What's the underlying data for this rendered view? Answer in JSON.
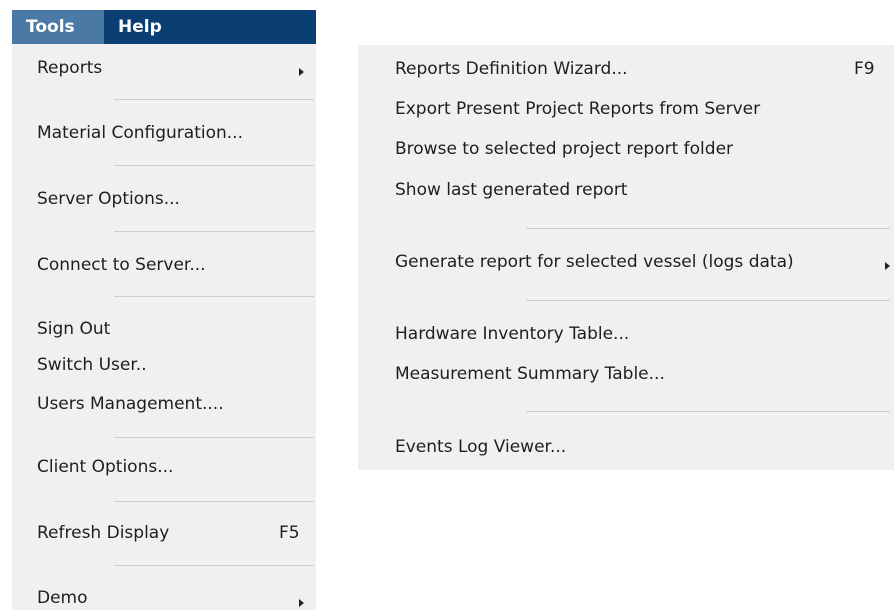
{
  "menubar": {
    "tools": "Tools",
    "help": "Help"
  },
  "tools_menu": {
    "reports": "Reports",
    "material_configuration": "Material Configuration...",
    "server_options": "Server Options...",
    "connect_to_server": "Connect to Server...",
    "sign_out": "Sign Out",
    "switch_user": "Switch User..",
    "users_management": "Users Management....",
    "client_options": "Client Options...",
    "refresh_display": "Refresh Display",
    "refresh_display_shortcut": "F5",
    "demo": "Demo"
  },
  "reports_submenu": {
    "reports_definition_wizard": "Reports Definition Wizard...",
    "reports_definition_wizard_shortcut": "F9",
    "export_present_project_reports": "Export Present Project Reports from Server",
    "browse_project_report_folder": "Browse to selected project report folder",
    "show_last_generated_report": "Show last generated report",
    "generate_report_selected_vessel": "Generate report for selected vessel (logs data)",
    "hardware_inventory_table": "Hardware Inventory Table...",
    "measurement_summary_table": "Measurement Summary Table...",
    "events_log_viewer": "Events Log Viewer..."
  },
  "colors": {
    "menubar_bg": "#0b3f73",
    "menubar_active": "#4a79a6",
    "menu_bg": "#f0f0f0",
    "separator": "#cfcfcf"
  }
}
